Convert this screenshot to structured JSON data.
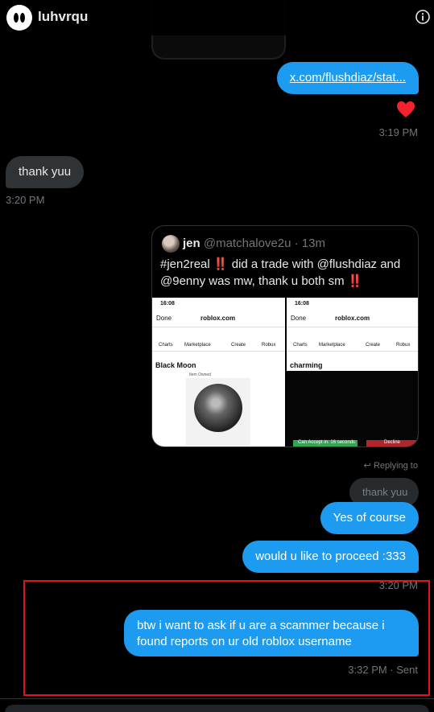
{
  "header": {
    "username": "luhvrqu",
    "avatar_icon": "ghost-eyes-avatar",
    "info_icon": "info-icon"
  },
  "messages": {
    "link_text": "x.com/flushdiaz/stat...",
    "reaction": "heart",
    "time1": "3:19 PM",
    "incoming_text": "thank yuu",
    "time2": "3:20 PM",
    "reply_label": "Replying to",
    "reply_quote": "thank yuu",
    "yes_text": "Yes of course",
    "proceed_text": "would u like to proceed :333",
    "time3": "3:20 PM",
    "scam_text": "btw i want to ask if u are a scammer because i found reports on ur old roblox username",
    "time4": "3:32 PM · Sent"
  },
  "tweet": {
    "name": "jen",
    "handle_time": "@matchalove2u · 13m",
    "text": "#jen2real ‼️ did a trade with @flushdiaz and @9enny was mw, thank u both sm ‼️",
    "shot_a": {
      "time": "16:08",
      "done": "Done",
      "url": "roblox.com",
      "nav": [
        "Charts",
        "Marketplace",
        "Create",
        "Robux"
      ],
      "title": "Black Moon",
      "owned": "Item Owned"
    },
    "shot_b": {
      "time": "16:08",
      "done": "Done",
      "url": "roblox.com",
      "nav": [
        "Charts",
        "Marketplace",
        "Create",
        "Robux"
      ],
      "title": "charming",
      "accept": "Can Accept in: 16 seconds",
      "decline": "Decline"
    }
  },
  "colors": {
    "accent": "#1d9bf0",
    "incoming": "#2f3336",
    "muted": "#71767b",
    "heart": "#f91880",
    "highlight": "#e0141e"
  }
}
